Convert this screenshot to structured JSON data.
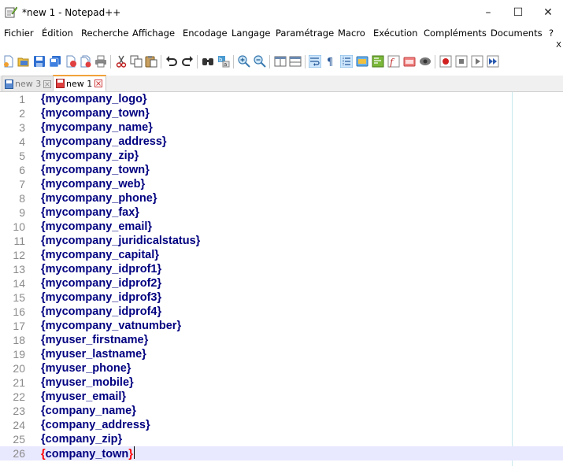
{
  "window": {
    "title": "*new 1 - Notepad++",
    "minimize": "–",
    "maximize": "☐",
    "close": "✕"
  },
  "menu": {
    "items": [
      "Fichier",
      "Édition",
      "Recherche",
      "Affichage",
      "Encodage",
      "Langage",
      "Paramétrage",
      "Macro",
      "Exécution",
      "Compléments",
      "Documents",
      "?"
    ],
    "close_doc": "X"
  },
  "toolbar": {
    "icons": [
      "new-file-icon",
      "open-file-icon",
      "save-icon",
      "save-all-icon",
      "close-icon",
      "close-all-icon",
      "print-icon",
      "cut-icon",
      "copy-icon",
      "paste-icon",
      "undo-icon",
      "redo-icon",
      "find-icon",
      "replace-icon",
      "zoom-in-icon",
      "zoom-out-icon",
      "sync-vertical-icon",
      "sync-horizontal-icon",
      "word-wrap-icon",
      "show-all-chars-icon",
      "indent-guide-icon",
      "user-language-icon",
      "document-map-icon",
      "function-list-icon",
      "folder-workspace-icon",
      "monitoring-icon",
      "record-macro-icon",
      "stop-macro-icon",
      "play-macro-icon",
      "run-macro-multiple-icon"
    ]
  },
  "tabs": [
    {
      "label": "new 3",
      "active": false
    },
    {
      "label": "new 1",
      "active": true
    }
  ],
  "editor": {
    "current_line": 26,
    "lines": [
      {
        "num": "1",
        "text": "{mycompany_logo}"
      },
      {
        "num": "2",
        "text": "{mycompany_town}"
      },
      {
        "num": "3",
        "text": "{mycompany_name}"
      },
      {
        "num": "4",
        "text": "{mycompany_address}"
      },
      {
        "num": "5",
        "text": "{mycompany_zip}"
      },
      {
        "num": "6",
        "text": "{mycompany_town}"
      },
      {
        "num": "7",
        "text": "{mycompany_web}"
      },
      {
        "num": "8",
        "text": "{mycompany_phone}"
      },
      {
        "num": "9",
        "text": "{mycompany_fax}"
      },
      {
        "num": "10",
        "text": "{mycompany_email}"
      },
      {
        "num": "11",
        "text": "{mycompany_juridicalstatus}"
      },
      {
        "num": "12",
        "text": "{mycompany_capital}"
      },
      {
        "num": "13",
        "text": "{mycompany_idprof1}"
      },
      {
        "num": "14",
        "text": "{mycompany_idprof2}"
      },
      {
        "num": "15",
        "text": "{mycompany_idprof3}"
      },
      {
        "num": "16",
        "text": "{mycompany_idprof4}"
      },
      {
        "num": "17",
        "text": "{mycompany_vatnumber}"
      },
      {
        "num": "18",
        "text": "{myuser_firstname}"
      },
      {
        "num": "19",
        "text": "{myuser_lastname}"
      },
      {
        "num": "20",
        "text": "{myuser_phone}"
      },
      {
        "num": "21",
        "text": "{myuser_mobile}"
      },
      {
        "num": "22",
        "text": "{myuser_email}"
      },
      {
        "num": "23",
        "text": "{company_name}"
      },
      {
        "num": "24",
        "text": "{company_address}"
      },
      {
        "num": "25",
        "text": "{company_zip}"
      },
      {
        "num": "26",
        "text_open": "{",
        "text_body": "company_town",
        "text_close": "}"
      }
    ]
  },
  "colors": {
    "code": "#000080",
    "line_number": "#8a8a8a",
    "current_line_bg": "#e8e8ff",
    "brace_match": "#ff0000",
    "active_tab_accent": "#f2a13a",
    "edge_line": "#c8e8ee"
  }
}
